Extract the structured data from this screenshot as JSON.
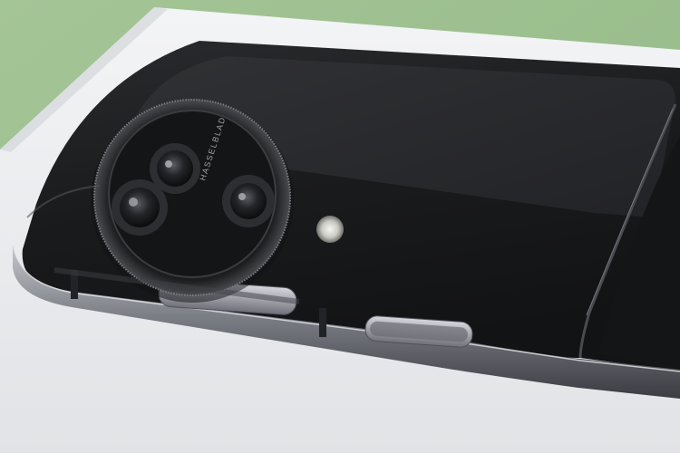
{
  "photo": {
    "subject": "phone-camera-closeup",
    "lens_brand_text": "HASSELBLAD",
    "colors": {
      "background_green": "#9cbf8e",
      "box_white": "#eceef0",
      "phone_body": "#1b1c1e",
      "glass_panel": "#2a2b2d",
      "frame_metal": "#8c8d94",
      "camera_ring": "#3a3b3e"
    }
  }
}
